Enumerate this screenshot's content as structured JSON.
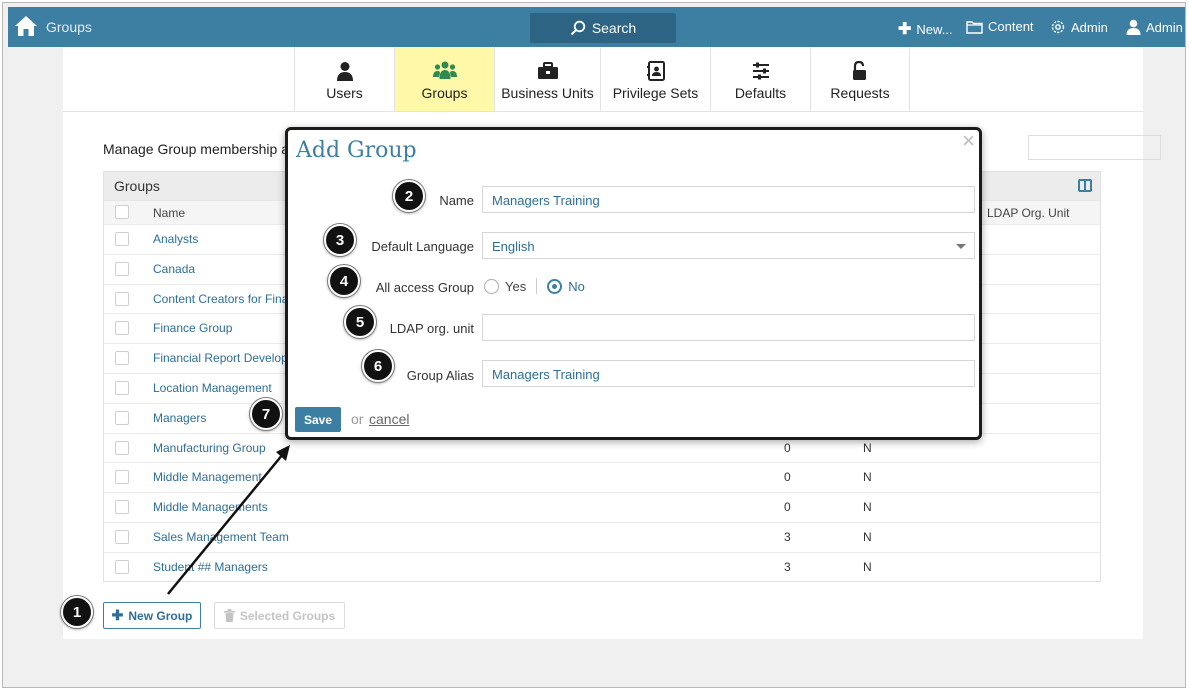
{
  "topbar": {
    "app_title": "Groups",
    "search_label": "Search",
    "new_label": "New...",
    "content_label": "Content",
    "admin_label": "Admin",
    "user_label": "Admin",
    "color": "#3d7fa3"
  },
  "tabs": [
    {
      "label": "Users",
      "icon": "user-icon",
      "active": false
    },
    {
      "label": "Groups",
      "icon": "groups-icon",
      "active": true
    },
    {
      "label": "Business Units",
      "icon": "briefcase-icon",
      "active": false
    },
    {
      "label": "Privilege Sets",
      "icon": "contact-book-icon",
      "active": false
    },
    {
      "label": "Defaults",
      "icon": "sliders-icon",
      "active": false
    },
    {
      "label": "Requests",
      "icon": "unlock-icon",
      "active": false
    }
  ],
  "intro_text": "Manage Group membership a",
  "grid": {
    "title": "Groups",
    "col_name": "Name",
    "col_ldap": "LDAP Org. Unit",
    "rows": [
      {
        "name": "Analysts",
        "count": "",
        "flag": ""
      },
      {
        "name": "Canada",
        "count": "",
        "flag": ""
      },
      {
        "name": "Content Creators for Fina",
        "count": "",
        "flag": ""
      },
      {
        "name": "Finance Group",
        "count": "",
        "flag": ""
      },
      {
        "name": "Financial Report Develop",
        "count": "",
        "flag": ""
      },
      {
        "name": "Location Management",
        "count": "",
        "flag": ""
      },
      {
        "name": "Managers",
        "count": "",
        "flag": ""
      },
      {
        "name": "Manufacturing Group",
        "count": "0",
        "flag": "N"
      },
      {
        "name": "Middle Management",
        "count": "0",
        "flag": "N"
      },
      {
        "name": "Middle Managements",
        "count": "0",
        "flag": "N"
      },
      {
        "name": "Sales Management Team",
        "count": "3",
        "flag": "N"
      },
      {
        "name": "Student ## Managers",
        "count": "3",
        "flag": "N"
      }
    ]
  },
  "buttons": {
    "new_group": "New Group",
    "selected_groups": "Selected Groups"
  },
  "modal": {
    "title": "Add Group",
    "close": "×",
    "name_label": "Name",
    "name_value": "Managers Training",
    "language_label": "Default Language",
    "language_value": "English",
    "all_access_label": "All access Group",
    "yes_label": "Yes",
    "no_label": "No",
    "all_access_selected": "No",
    "ldap_label": "LDAP org. unit",
    "ldap_value": "",
    "alias_label": "Group Alias",
    "alias_value": "Managers Training",
    "save_label": "Save",
    "or_text": "or",
    "cancel_label": "cancel"
  },
  "callouts": [
    "1",
    "2",
    "3",
    "4",
    "5",
    "6",
    "7"
  ]
}
